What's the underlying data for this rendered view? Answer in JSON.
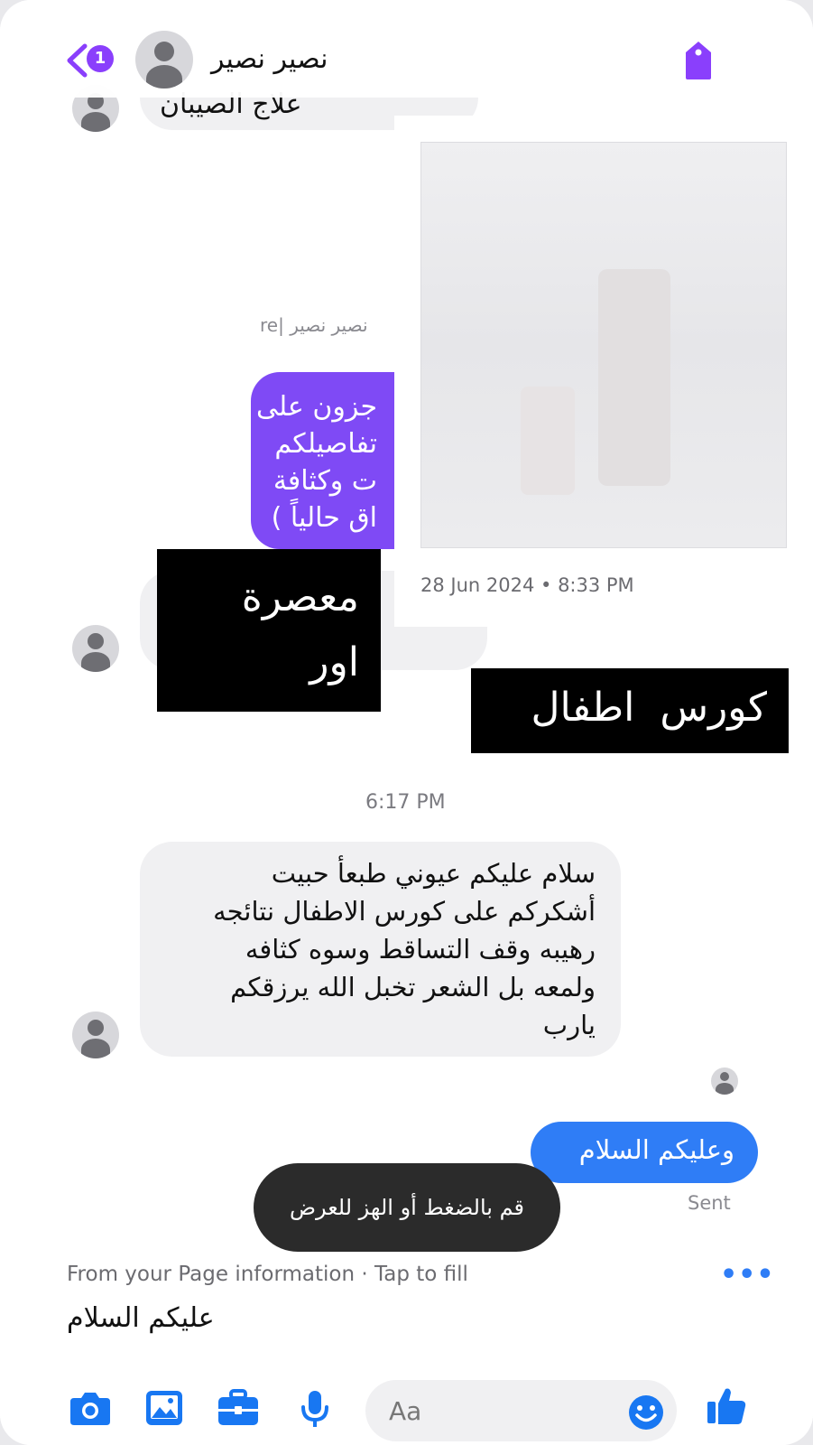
{
  "header": {
    "back_badge": "1",
    "contact_name": "نصير نصير"
  },
  "messages": {
    "partial_top_text": "علاج الصيبان",
    "reply_label": "re| نصير نصير",
    "purple_lines": [
      "جزون على",
      "تفاصيلكم",
      "ت وكثافة",
      "اق حالياً )"
    ],
    "card_date": "28 Jun 2024 • 8:33 PM",
    "black_box_left": [
      "معصرة",
      "اور"
    ],
    "black_box_right": "كورس  اطفال",
    "time_label": "6:17 PM",
    "incoming_main": [
      "سلام عليكم عيوني طبعأ حبيت",
      "أشكركم على كورس الاطفال نتائجه",
      "رهيبه وقف التساقط وسوه كثافه",
      "ولمعه بل الشعر تخبل  الله يرزقكم",
      "يارب"
    ],
    "outgoing_text": "وعليكم السلام",
    "sent_status": "Sent"
  },
  "toast": {
    "text": "قم بالضغط أو الهز للعرض"
  },
  "suggestion": {
    "info": "From your Page information · Tap to fill",
    "more": "•••",
    "text": "عليكم السلام"
  },
  "composer": {
    "placeholder": "Aa",
    "icons": [
      "camera-icon",
      "image-icon",
      "briefcase-icon",
      "mic-icon",
      "emoji-icon",
      "thumbs-up-icon"
    ]
  },
  "colors": {
    "accent_purple": "#8a3ffc",
    "bubble_purple": "#7f4af5",
    "bubble_blue": "#2f7df6",
    "icon_blue": "#1877f2"
  }
}
